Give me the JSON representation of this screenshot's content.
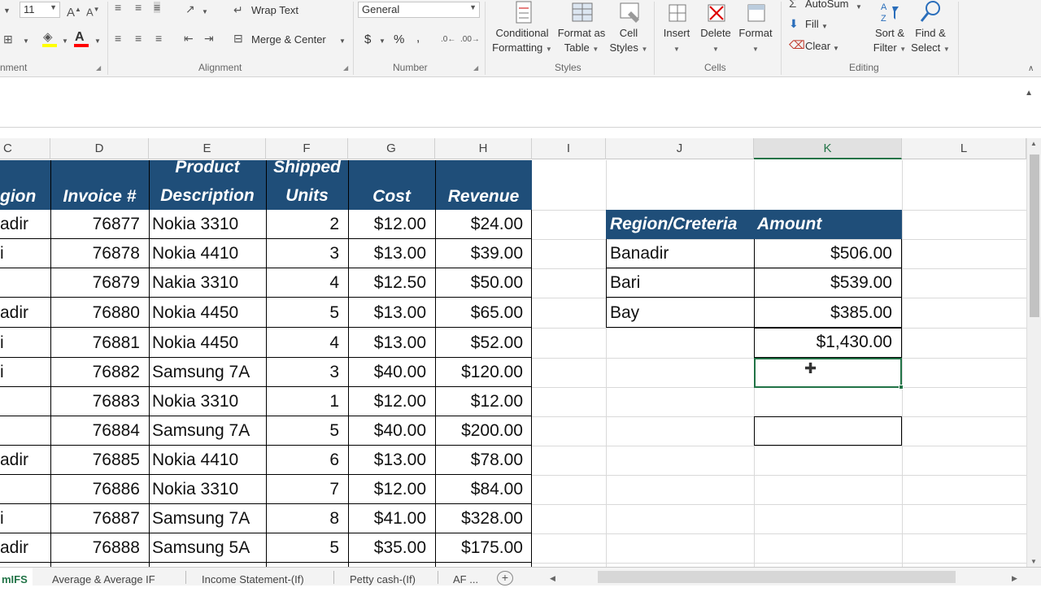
{
  "ribbon": {
    "font_size": "11",
    "wrap_text": "Wrap Text",
    "merge_center": "Merge & Center",
    "number_format": "General",
    "currency": "$",
    "percent": "%",
    "comma": ",",
    "alignment_group_partial": "nment",
    "alignment_group": "Alignment",
    "number_group": "Number",
    "styles_group": "Styles",
    "cells_group": "Cells",
    "editing_group": "Editing",
    "conditional_formatting": [
      "Conditional",
      "Formatting"
    ],
    "format_as_table": [
      "Format as",
      "Table"
    ],
    "cell_styles": [
      "Cell",
      "Styles"
    ],
    "insert": "Insert",
    "delete": "Delete",
    "format": "Format",
    "autosum": "AutoSum",
    "fill": "Fill",
    "clear": "Clear",
    "sort_filter": [
      "Sort &",
      "Filter"
    ],
    "find_select": [
      "Find &",
      "Select"
    ],
    "colors": {
      "highlight": "#ffff00",
      "font": "#ff0000"
    }
  },
  "columns": [
    "C",
    "D",
    "E",
    "F",
    "G",
    "H",
    "I",
    "J",
    "K",
    "L"
  ],
  "table": {
    "headers": {
      "region_partial": "gion",
      "invoice": "Invoice #",
      "product_1": "Product",
      "product_2": "Description",
      "shipped_1": "Shipped",
      "shipped_2": "Units",
      "cost": "Cost",
      "revenue": "Revenue"
    },
    "rows": [
      {
        "region": "adir",
        "invoice": "76877",
        "product": "Nokia 3310",
        "units": "2",
        "cost": "$12.00",
        "revenue": "$24.00"
      },
      {
        "region": "i",
        "invoice": "76878",
        "product": "Nokia 4410",
        "units": "3",
        "cost": "$13.00",
        "revenue": "$39.00"
      },
      {
        "region": "",
        "invoice": "76879",
        "product": "Nakia 3310",
        "units": "4",
        "cost": "$12.50",
        "revenue": "$50.00"
      },
      {
        "region": "adir",
        "invoice": "76880",
        "product": "Nokia 4450",
        "units": "5",
        "cost": "$13.00",
        "revenue": "$65.00"
      },
      {
        "region": "i",
        "invoice": "76881",
        "product": "Nokia 4450",
        "units": "4",
        "cost": "$13.00",
        "revenue": "$52.00"
      },
      {
        "region": "i",
        "invoice": "76882",
        "product": "Samsung 7A",
        "units": "3",
        "cost": "$40.00",
        "revenue": "$120.00"
      },
      {
        "region": "",
        "invoice": "76883",
        "product": "Nokia 3310",
        "units": "1",
        "cost": "$12.00",
        "revenue": "$12.00"
      },
      {
        "region": "",
        "invoice": "76884",
        "product": "Samsung 7A",
        "units": "5",
        "cost": "$40.00",
        "revenue": "$200.00"
      },
      {
        "region": "adir",
        "invoice": "76885",
        "product": "Nokia 4410",
        "units": "6",
        "cost": "$13.00",
        "revenue": "$78.00"
      },
      {
        "region": "",
        "invoice": "76886",
        "product": "Nokia 3310",
        "units": "7",
        "cost": "$12.00",
        "revenue": "$84.00"
      },
      {
        "region": "i",
        "invoice": "76887",
        "product": "Samsung 7A",
        "units": "8",
        "cost": "$41.00",
        "revenue": "$328.00"
      },
      {
        "region": "adir",
        "invoice": "76888",
        "product": "Samsung 5A",
        "units": "5",
        "cost": "$35.00",
        "revenue": "$175.00"
      }
    ]
  },
  "summary": {
    "header_region": "Region/Creteria",
    "header_amount": "Amount",
    "rows": [
      {
        "region": "Banadir",
        "amount": "$506.00"
      },
      {
        "region": "Bari",
        "amount": "$539.00"
      },
      {
        "region": "Bay",
        "amount": "$385.00"
      }
    ],
    "total": "$1,430.00"
  },
  "sheet_tabs": [
    "mIFS",
    "Average & Average IF",
    "Income Statement-(If)",
    "Petty cash-(If)",
    "AF ..."
  ],
  "active_tab": "mIFS"
}
